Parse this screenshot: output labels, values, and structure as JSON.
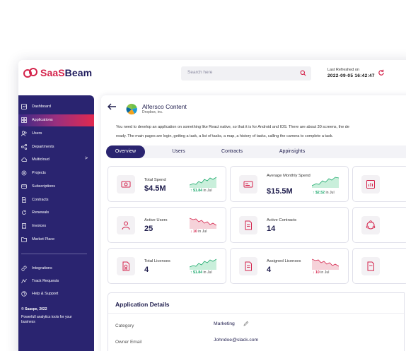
{
  "header": {
    "logo_prefix": "SaaS",
    "logo_suffix": "Beam",
    "search_placeholder": "Search here",
    "refresh_label": "Last Refreshed on",
    "refresh_time": "2022-09-05  16:42:47"
  },
  "sidebar": {
    "items": [
      {
        "label": "Dashboard",
        "icon": "dashboard-icon"
      },
      {
        "label": "Applications",
        "icon": "grid-icon",
        "active": true
      },
      {
        "label": "Users",
        "icon": "users-icon"
      },
      {
        "label": "Departments",
        "icon": "departments-icon"
      },
      {
        "label": "Multicloud",
        "icon": "cloud-icon",
        "chevron": ">"
      },
      {
        "label": "Projects",
        "icon": "projects-icon"
      },
      {
        "label": "Subscriptions",
        "icon": "subscriptions-icon"
      },
      {
        "label": "Contracts",
        "icon": "contracts-icon"
      },
      {
        "label": "Renewals",
        "icon": "renewals-icon"
      },
      {
        "label": "Invoices",
        "icon": "invoices-icon"
      },
      {
        "label": "Market Place",
        "icon": "folder-icon"
      }
    ],
    "bottom_items": [
      {
        "label": "Integrations",
        "icon": "link-icon"
      },
      {
        "label": "Track Requests",
        "icon": "track-icon"
      },
      {
        "label": "Help & Support",
        "icon": "help-icon"
      }
    ],
    "copyright": "© Saaspe, 2022",
    "tagline": "Powerfull analytics tools for your business"
  },
  "app": {
    "name": "Alfersco Content",
    "vendor": "Dropbox, inc.",
    "description_line1": "You need to develop an application on something like React native, so that it is for Android and IOS. There are about 30 screens, the de",
    "description_line2": "ready. The main pages are login, getting a task, a list of tasks, a map, a history of tasks, calling the camera to complete a task."
  },
  "tabs": [
    "Overview",
    "Users",
    "Contracts",
    "Appinsights"
  ],
  "cards": [
    {
      "label": "Total Spend",
      "value": "$4.5M",
      "trend_dir": "up",
      "trend_value": "$1.84",
      "trend_suffix": "in Jul"
    },
    {
      "label": "Average Monthly Spend",
      "value": "$15.5M",
      "trend_dir": "up",
      "trend_value": "$2.52",
      "trend_suffix": "in Jul"
    },
    {
      "label": "Active Users",
      "value": "25",
      "trend_dir": "down",
      "trend_value": "10",
      "trend_suffix": "in Jul"
    },
    {
      "label": "Active Contracts",
      "value": "14"
    },
    {
      "label": "Total Licenses",
      "value": "4",
      "trend_dir": "up",
      "trend_value": "$1.84",
      "trend_suffix": "in Jul"
    },
    {
      "label": "Assigned Licenses",
      "value": "4",
      "trend_dir": "down",
      "trend_value": "10",
      "trend_suffix": "in Jul"
    }
  ],
  "details": {
    "title": "Application Details",
    "rows": [
      {
        "label": "Category",
        "value": "Marketing"
      },
      {
        "label": "Owner Email",
        "value": "Johndoe@slack.com"
      }
    ]
  },
  "colors": {
    "brand_red": "#d4234b",
    "brand_navy": "#2a2470",
    "up_green": "#19a86a",
    "down_red": "#d4234b"
  }
}
